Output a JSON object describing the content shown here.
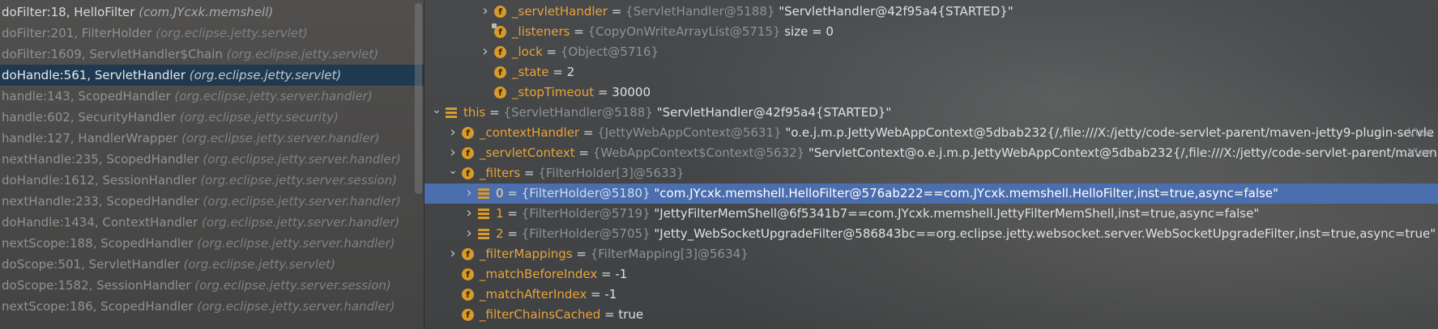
{
  "stack_frames": [
    {
      "method": "doFilter:18, HelloFilter",
      "pkg": "(com.JYcxk.memshell)",
      "state": "bright"
    },
    {
      "method": "doFilter:201, FilterHolder",
      "pkg": "(org.eclipse.jetty.servlet)",
      "state": "dim"
    },
    {
      "method": "doFilter:1609, ServletHandler$Chain",
      "pkg": "(org.eclipse.jetty.servlet)",
      "state": "dim"
    },
    {
      "method": "doHandle:561, ServletHandler",
      "pkg": "(org.eclipse.jetty.servlet)",
      "state": "selected"
    },
    {
      "method": "handle:143, ScopedHandler",
      "pkg": "(org.eclipse.jetty.server.handler)",
      "state": "dim"
    },
    {
      "method": "handle:602, SecurityHandler",
      "pkg": "(org.eclipse.jetty.security)",
      "state": "dim"
    },
    {
      "method": "handle:127, HandlerWrapper",
      "pkg": "(org.eclipse.jetty.server.handler)",
      "state": "dim"
    },
    {
      "method": "nextHandle:235, ScopedHandler",
      "pkg": "(org.eclipse.jetty.server.handler)",
      "state": "dim"
    },
    {
      "method": "doHandle:1612, SessionHandler",
      "pkg": "(org.eclipse.jetty.server.session)",
      "state": "dim"
    },
    {
      "method": "nextHandle:233, ScopedHandler",
      "pkg": "(org.eclipse.jetty.server.handler)",
      "state": "dim"
    },
    {
      "method": "doHandle:1434, ContextHandler",
      "pkg": "(org.eclipse.jetty.server.handler)",
      "state": "dim"
    },
    {
      "method": "nextScope:188, ScopedHandler",
      "pkg": "(org.eclipse.jetty.server.handler)",
      "state": "dim"
    },
    {
      "method": "doScope:501, ServletHandler",
      "pkg": "(org.eclipse.jetty.servlet)",
      "state": "dim"
    },
    {
      "method": "doScope:1582, SessionHandler",
      "pkg": "(org.eclipse.jetty.server.session)",
      "state": "dim"
    },
    {
      "method": "nextScope:186, ScopedHandler",
      "pkg": "(org.eclipse.jetty.server.handler)",
      "state": "dim"
    }
  ],
  "variables": [
    {
      "indent": 3,
      "expand": "collapsed",
      "icon": "field-icon",
      "name": "_servletHandler",
      "ref": "{ServletHandler@5188}",
      "value": "\"ServletHandler@42f95a4{STARTED}\"",
      "selected": false
    },
    {
      "indent": 3,
      "expand": "none",
      "icon": "field-lock-icon",
      "name": "_listeners",
      "ref": "{CopyOnWriteArrayList@5715}",
      "value": " size = 0",
      "selected": false
    },
    {
      "indent": 3,
      "expand": "collapsed",
      "icon": "field-icon",
      "name": "_lock",
      "ref": "{Object@5716}",
      "value": "",
      "selected": false
    },
    {
      "indent": 3,
      "expand": "none",
      "icon": "field-icon",
      "name": "_state",
      "ref": "",
      "value": "2",
      "selected": false
    },
    {
      "indent": 3,
      "expand": "none",
      "icon": "field-icon",
      "name": "_stopTimeout",
      "ref": "",
      "value": "30000",
      "selected": false
    },
    {
      "indent": 0,
      "expand": "expanded",
      "icon": "array-icon",
      "name": "this",
      "ref": "{ServletHandler@5188}",
      "value": "\"ServletHandler@42f95a4{STARTED}\"",
      "selected": false
    },
    {
      "indent": 1,
      "expand": "collapsed",
      "icon": "field-icon",
      "name": "_contextHandler",
      "ref": "{JettyWebAppContext@5631}",
      "value": "\"o.e.j.m.p.JettyWebAppContext@5dbab232{/,file:///X:/jetty/code-servlet-parent/maven-jetty9-plugin-servle",
      "selected": false,
      "ellipsis": "...View"
    },
    {
      "indent": 1,
      "expand": "collapsed",
      "icon": "field-icon",
      "name": "_servletContext",
      "ref": "{WebAppContext$Context@5632}",
      "value": "\"ServletContext@o.e.j.m.p.JettyWebAppContext@5dbab232{/,file:///X:/jetty/code-servlet-parent/maven",
      "selected": false,
      "ellipsis": "...View"
    },
    {
      "indent": 1,
      "expand": "expanded",
      "icon": "field-icon",
      "name": "_filters",
      "ref": "{FilterHolder[3]@5633}",
      "value": "",
      "selected": false
    },
    {
      "indent": 2,
      "expand": "collapsed",
      "icon": "array-icon",
      "name": "0",
      "ref": "{FilterHolder@5180}",
      "value": "\"com.JYcxk.memshell.HelloFilter@576ab222==com.JYcxk.memshell.HelloFilter,inst=true,async=false\"",
      "selected": true
    },
    {
      "indent": 2,
      "expand": "collapsed",
      "icon": "array-icon",
      "name": "1",
      "ref": "{FilterHolder@5719}",
      "value": "\"JettyFilterMemShell@6f5341b7==com.JYcxk.memshell.JettyFilterMemShell,inst=true,async=false\"",
      "selected": false
    },
    {
      "indent": 2,
      "expand": "collapsed",
      "icon": "array-icon",
      "name": "2",
      "ref": "{FilterHolder@5705}",
      "value": "\"Jetty_WebSocketUpgradeFilter@586843bc==org.eclipse.jetty.websocket.server.WebSocketUpgradeFilter,inst=true,async=true\"",
      "selected": false
    },
    {
      "indent": 1,
      "expand": "collapsed",
      "icon": "field-icon",
      "name": "_filterMappings",
      "ref": "{FilterMapping[3]@5634}",
      "value": "",
      "selected": false
    },
    {
      "indent": 1,
      "expand": "none",
      "icon": "field-icon",
      "name": "_matchBeforeIndex",
      "ref": "",
      "value": "-1",
      "selected": false
    },
    {
      "indent": 1,
      "expand": "none",
      "icon": "field-icon",
      "name": "_matchAfterIndex",
      "ref": "",
      "value": "-1",
      "selected": false
    },
    {
      "indent": 1,
      "expand": "none",
      "icon": "field-icon",
      "name": "_filterChainsCached",
      "ref": "",
      "value": "true",
      "selected": false
    }
  ],
  "colors": {
    "selected_frame": "#1f3a50",
    "selected_variable": "#4b6eaf",
    "field_icon": "#d79a2b"
  }
}
